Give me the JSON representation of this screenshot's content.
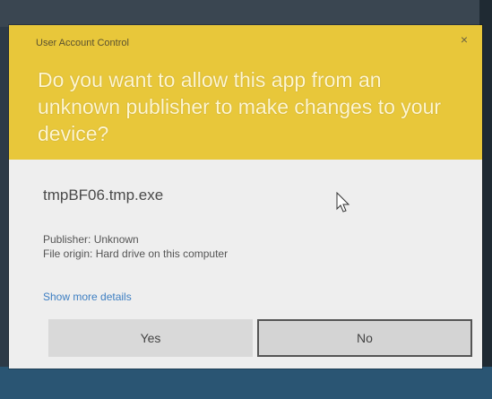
{
  "dialog": {
    "caption": "User Account Control",
    "close_glyph": "×",
    "question": "Do you want to allow this app from an unknown publisher to make changes to your device?",
    "app_name": "tmpBF06.tmp.exe",
    "publisher": "Publisher: Unknown",
    "file_origin": "File origin: Hard drive on this computer",
    "more_details": "Show more details",
    "yes_label": "Yes",
    "no_label": "No"
  },
  "colors": {
    "header": "#e8c73a",
    "body": "#eeeeee",
    "link": "#3e7fc2"
  },
  "icons": [
    "close-icon",
    "mouse-pointer-icon"
  ]
}
